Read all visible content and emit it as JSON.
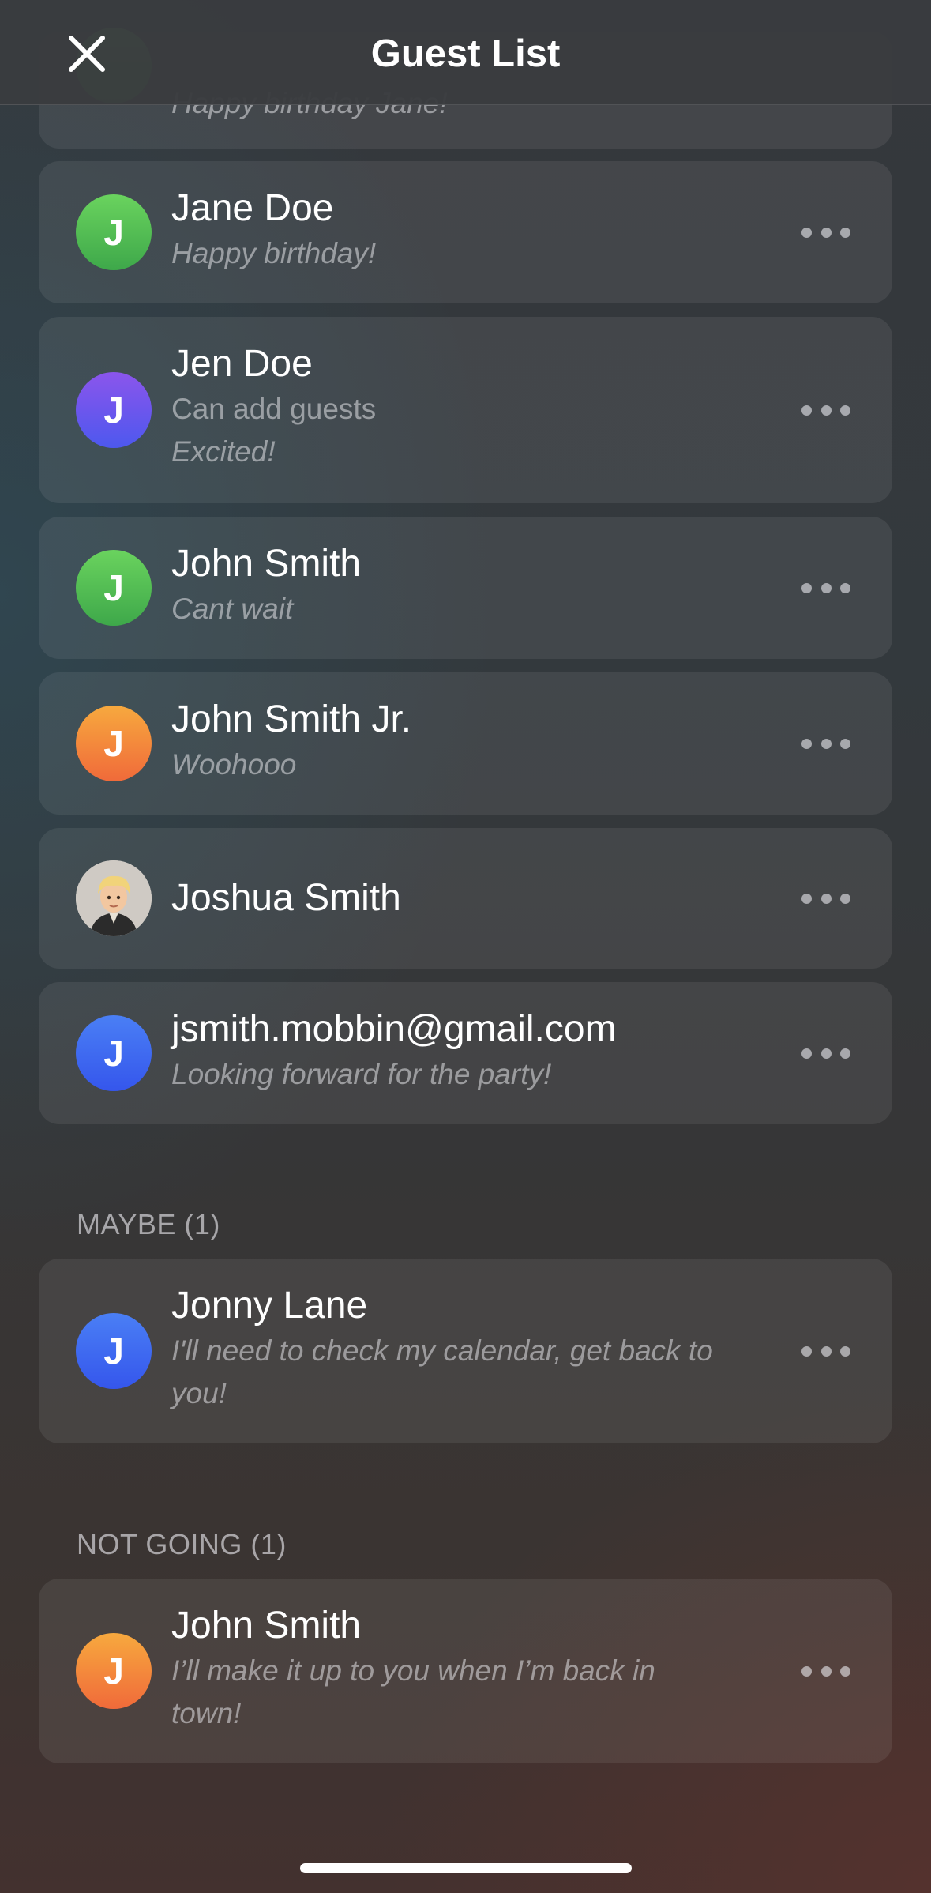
{
  "header": {
    "title": "Guest List",
    "close_icon": "close-icon"
  },
  "going_guests": [
    {
      "name": "",
      "note": "Happy birthday Jane!",
      "avatar_letter": "J",
      "avatar_color": "#4fbf55"
    },
    {
      "name": "Jane Doe",
      "note": "Happy birthday!",
      "avatar_letter": "J",
      "avatar_color": "#4fbf55"
    },
    {
      "name": "Jen Doe",
      "permission": "Can add guests",
      "note": "Excited!",
      "avatar_letter": "J",
      "avatar_color": "#6b57ee"
    },
    {
      "name": "John Smith",
      "note": "Cant wait",
      "avatar_letter": "J",
      "avatar_color": "#4fbf55"
    },
    {
      "name": "John Smith Jr.",
      "note": "Woohooo",
      "avatar_letter": "J",
      "avatar_color": "#f3873c"
    },
    {
      "name": "Joshua Smith",
      "avatar_icon": "memoji-avatar"
    },
    {
      "name": "jsmith.mobbin@gmail.com",
      "note": "Looking forward for the party!",
      "avatar_letter": "J",
      "avatar_color": "#3f6cf0"
    }
  ],
  "maybe_section": {
    "label": "MAYBE (1)",
    "guests": [
      {
        "name": "Jonny Lane",
        "note": "I'll need to check my calendar, get back to you!",
        "avatar_letter": "J",
        "avatar_color": "#3f6cf0"
      }
    ]
  },
  "not_going_section": {
    "label": "NOT GOING (1)",
    "guests": [
      {
        "name": "John Smith",
        "note": "I’ll make it up to you when I’m back in town!",
        "avatar_letter": "J",
        "avatar_color": "#f3873c"
      }
    ]
  },
  "more_icon": "more-horizontal-icon"
}
